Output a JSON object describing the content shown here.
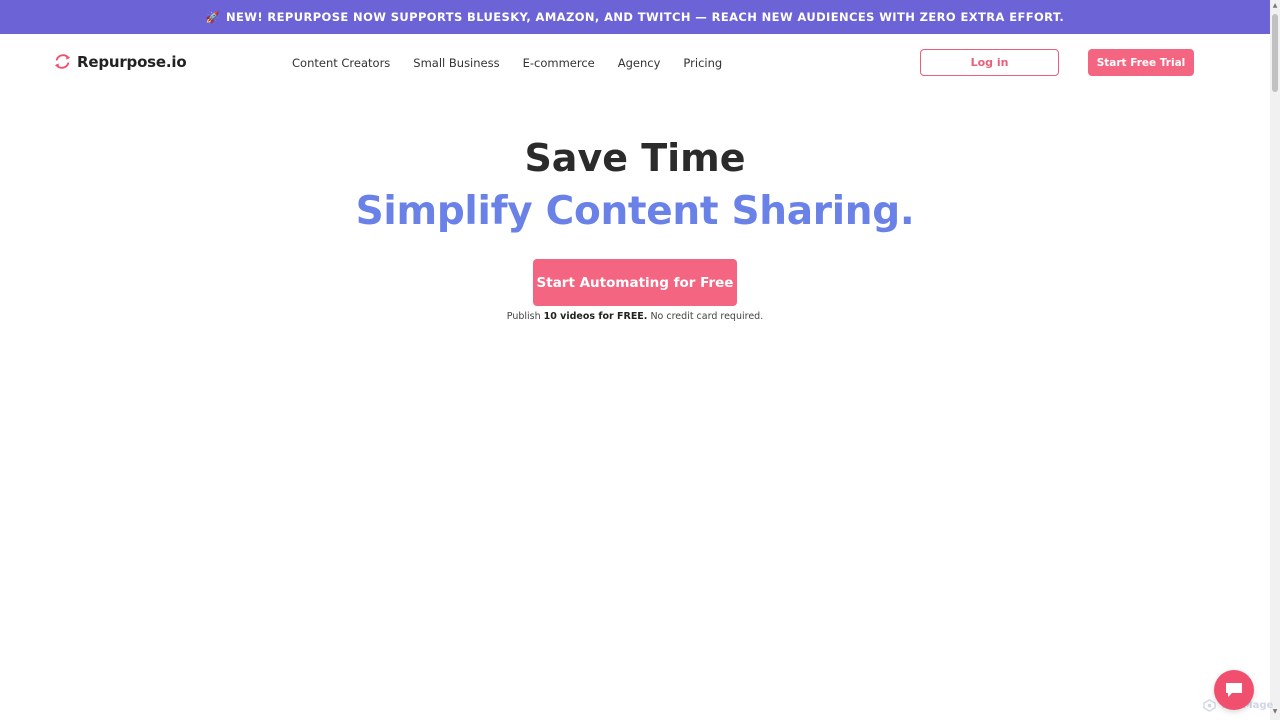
{
  "banner": {
    "icon": "rocket-icon",
    "text": "NEW! REPURPOSE NOW SUPPORTS BLUESKY, AMAZON, AND TWITCH — REACH NEW AUDIENCES WITH ZERO EXTRA EFFORT."
  },
  "nav": {
    "logo_text": "Repurpose.io",
    "items": [
      {
        "label": "Content Creators"
      },
      {
        "label": "Small Business"
      },
      {
        "label": "E-commerce"
      },
      {
        "label": "Agency"
      },
      {
        "label": "Pricing"
      }
    ],
    "login_label": "Log in",
    "trial_label": "Start Free Trial"
  },
  "hero": {
    "title": "Save Time",
    "subtitle": "Simplify Content Sharing.",
    "cta_label": "Start Automating for Free",
    "note_prefix": "Publish ",
    "note_bold": "10 videos for FREE.",
    "note_suffix": " No credit card required."
  },
  "watermark": {
    "text": "ToolMage"
  },
  "colors": {
    "banner": "#6b63d6",
    "accent": "#f46581",
    "subtitle": "#6a82e8"
  }
}
